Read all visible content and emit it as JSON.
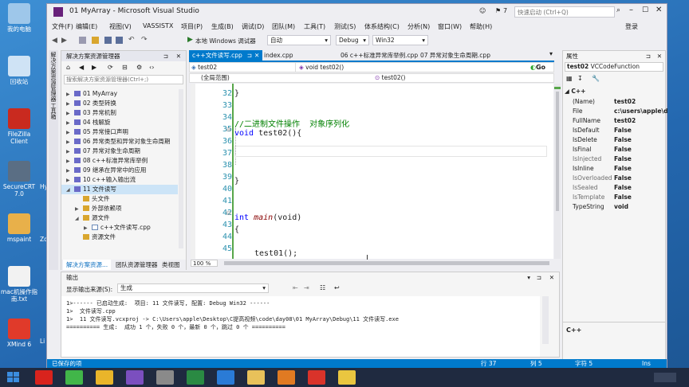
{
  "desktop": {
    "icons": [
      {
        "label": "我的电脑",
        "icon": "computer-icon",
        "color": "#9ec7ea"
      },
      {
        "label": "回收站",
        "icon": "recycle-bin-icon",
        "color": "#cfe3f5"
      },
      {
        "label": "FileZilla Client",
        "icon": "filezilla-icon",
        "color": "#c92a1f"
      },
      {
        "label": "SecureCRT 7.0",
        "icon": "securecrt-icon",
        "color": "#5a6e84"
      },
      {
        "label": "mspaint",
        "icon": "paint-icon",
        "color": "#e8b04a"
      },
      {
        "label": "mac机操作指南.txt",
        "icon": "text-file-icon",
        "color": "#f2f2f2"
      },
      {
        "label": "XMind 6",
        "icon": "xmind-icon",
        "color": "#e03a2a"
      }
    ],
    "partial_labels": [
      "Hy",
      "Zo",
      "Li"
    ]
  },
  "window": {
    "title": "01 MyArray - Microsoft Visual Studio",
    "notifications": "7",
    "quick_launch_placeholder": "快速启动 (Ctrl+Q)",
    "login": "登录"
  },
  "menu": [
    "文件(F)",
    "编辑(E)",
    "视图(V)",
    "VASSISTX",
    "项目(P)",
    "生成(B)",
    "调试(D)",
    "团队(M)",
    "工具(T)",
    "测试(S)",
    "体系结构(C)",
    "分析(N)",
    "窗口(W)",
    "帮助(H)"
  ],
  "toolbar": {
    "run_label": "本地 Windows 调试器",
    "run_mode": "自动",
    "config": "Debug",
    "platform": "Win32"
  },
  "solution_explorer": {
    "title": "解决方案资源管理器",
    "search_placeholder": "搜索解决方案资源管理器(Ctrl+;)",
    "items": [
      {
        "label": "01 MyArray",
        "indent": 0,
        "type": "proj",
        "fold": "▶"
      },
      {
        "label": "02 类型转换",
        "indent": 0,
        "type": "proj",
        "fold": "▶"
      },
      {
        "label": "03 异常机制",
        "indent": 0,
        "type": "proj",
        "fold": "▶"
      },
      {
        "label": "04 栈解旋",
        "indent": 0,
        "type": "proj",
        "fold": "▶"
      },
      {
        "label": "05 异常接口声明",
        "indent": 0,
        "type": "proj",
        "fold": "▶"
      },
      {
        "label": "06 异常类型和异常对象生命周期",
        "indent": 0,
        "type": "proj",
        "fold": "▶"
      },
      {
        "label": "07 异常对象生命周期",
        "indent": 0,
        "type": "proj",
        "fold": "▶"
      },
      {
        "label": "08 c++标准异常库举例",
        "indent": 0,
        "type": "proj",
        "fold": "▶"
      },
      {
        "label": "09 继承在异常中的应用",
        "indent": 0,
        "type": "proj",
        "fold": "▶"
      },
      {
        "label": "10 c++输入输出流",
        "indent": 0,
        "type": "proj",
        "fold": "▶"
      },
      {
        "label": "11 文件读写",
        "indent": 0,
        "type": "proj",
        "fold": "◢",
        "selected": true
      },
      {
        "label": "头文件",
        "indent": 1,
        "type": "folder",
        "fold": ""
      },
      {
        "label": "外部依赖项",
        "indent": 1,
        "type": "folder",
        "fold": "▶"
      },
      {
        "label": "源文件",
        "indent": 1,
        "type": "folder",
        "fold": "◢"
      },
      {
        "label": "c++文件读写.cpp",
        "indent": 2,
        "type": "file",
        "fold": "▶"
      },
      {
        "label": "资源文件",
        "indent": 1,
        "type": "folder",
        "fold": ""
      }
    ],
    "bottom_tabs": [
      "解决方案资源...",
      "团队资源管理器",
      "类视图"
    ]
  },
  "side_strip": [
    "解决方案资源管理器",
    "工具箱"
  ],
  "editor": {
    "tabs": [
      {
        "label": "c++文件读写.cpp",
        "active": true
      },
      {
        "label": "index.cpp",
        "active": false
      },
      {
        "label": "06 c++标准异常库举例.cpp",
        "active": false
      },
      {
        "label": "07 异常对象生命周期.cpp",
        "active": false
      }
    ],
    "nav_project": "test02",
    "nav_function": "void test02()",
    "go_label": "Go",
    "scope": "(全局范围)",
    "member": "test02()",
    "zoom": "100 %",
    "line_numbers": [
      "32",
      "33",
      "34",
      "35",
      "36",
      "37",
      "38",
      "39",
      "40",
      "41",
      "42",
      "43",
      "44",
      "45"
    ],
    "code": {
      "l32": "}",
      "l34": "//二进制文件操作  对象序列化",
      "l35_kw": "void",
      "l35_rest": " test02(){",
      "l39": "}",
      "l42_kw": "int",
      "l42_fn": "main",
      "l42_rest": "(void)",
      "l43": "{",
      "l45": "test01();"
    }
  },
  "properties": {
    "title": "属性",
    "object": "test02",
    "object_type": "VCCodeFunction",
    "category": "C++",
    "rows": [
      {
        "k": "(Name)",
        "v": "test02",
        "dim": false
      },
      {
        "k": "File",
        "v": "c:\\users\\apple\\d",
        "dim": false
      },
      {
        "k": "FullName",
        "v": "test02",
        "dim": false
      },
      {
        "k": "IsDefault",
        "v": "False",
        "dim": false
      },
      {
        "k": "IsDelete",
        "v": "False",
        "dim": false
      },
      {
        "k": "IsFinal",
        "v": "False",
        "dim": false
      },
      {
        "k": "IsInjected",
        "v": "False",
        "dim": true
      },
      {
        "k": "IsInline",
        "v": "False",
        "dim": false
      },
      {
        "k": "IsOverloaded",
        "v": "False",
        "dim": true
      },
      {
        "k": "IsSealed",
        "v": "False",
        "dim": true
      },
      {
        "k": "IsTemplate",
        "v": "False",
        "dim": true
      },
      {
        "k": "TypeString",
        "v": "void",
        "dim": false
      }
    ],
    "description": "C++"
  },
  "output": {
    "title": "输出",
    "source_label": "显示输出来源(S):",
    "source_value": "生成",
    "lines": [
      "1>------ 已启动生成:  项目: 11 文件读写, 配置: Debug Win32 ------",
      "1>  文件读写.cpp",
      "1>  11 文件读写.vcxproj -> C:\\Users\\apple\\Desktop\\C提高视频\\code\\day08\\01 MyArray\\Debug\\11 文件读写.exe",
      "========== 生成:  成功 1 个，失败 0 个，最新 0 个，跳过 0 个 =========="
    ]
  },
  "statusbar": {
    "left": "已保存的项",
    "line": "行 37",
    "col": "列 5",
    "char": "字符 5",
    "mode": "Ins"
  },
  "taskbar": {
    "apps": [
      {
        "name": "start-icon",
        "color": "#3b8de0"
      },
      {
        "name": "record-icon",
        "color": "#d8231d"
      },
      {
        "name": "qt-icon",
        "color": "#41b649"
      },
      {
        "name": "chrome-icon",
        "color": "#e9b52a"
      },
      {
        "name": "visual-studio-icon",
        "color": "#7b4fbf"
      },
      {
        "name": "vassistx-icon",
        "color": "#8a8a8a"
      },
      {
        "name": "excel-icon",
        "color": "#2a8a43"
      },
      {
        "name": "ie-icon",
        "color": "#2a7bd6"
      },
      {
        "name": "explorer-icon",
        "color": "#e8c15a"
      },
      {
        "name": "snagit-icon",
        "color": "#e07a22"
      },
      {
        "name": "xmind-icon",
        "color": "#d9332a"
      },
      {
        "name": "feiq-icon",
        "color": "#e9c640"
      }
    ]
  }
}
